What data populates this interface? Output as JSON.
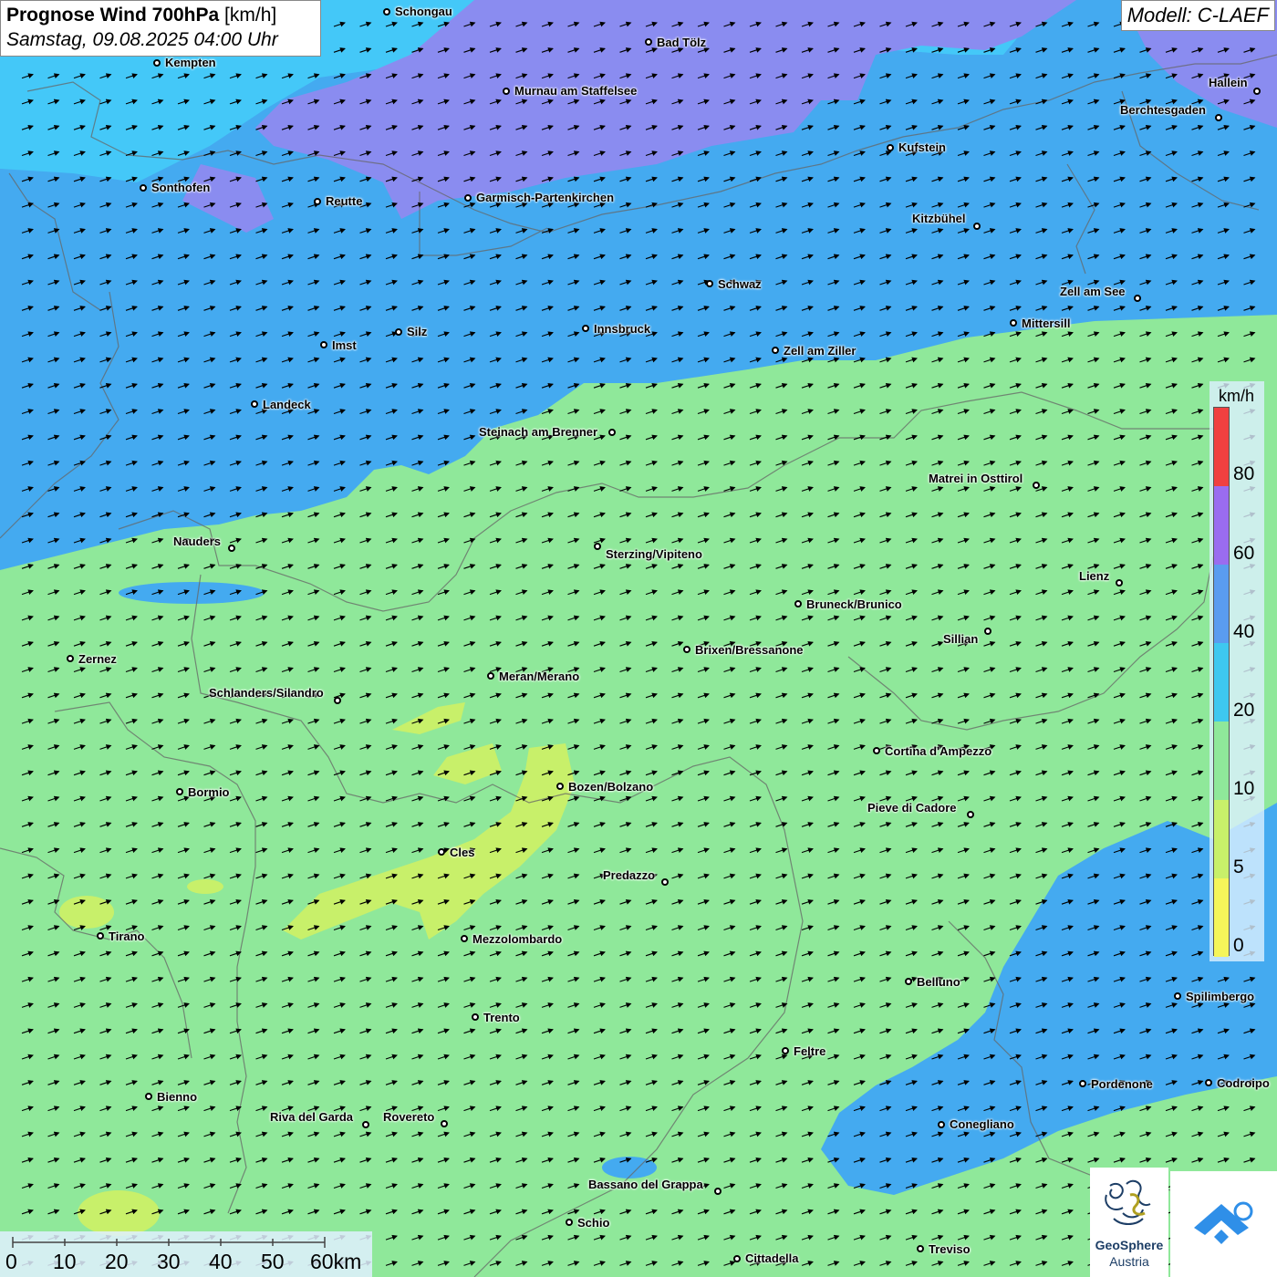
{
  "title": {
    "bold": "Prognose Wind 700hPa",
    "unit": "[km/h]",
    "datetime": "Samstag, 09.08.2025 04:00 Uhr"
  },
  "model": "Modell: C-LAEF",
  "colors": {
    "speed_0": "#f5f55a",
    "speed_5": "#c8f06a",
    "speed_10": "#8fe89a",
    "speed_20": "#3ec8f0",
    "speed_40": "#5a9cf0",
    "speed_60": "#9a6cf0",
    "speed_80": "#f04040",
    "blue_region": "#44aaf0",
    "violet_region": "#8a8cf0",
    "sky_region": "#44c8f8"
  },
  "legend": {
    "unit": "km/h",
    "labels": [
      "80",
      "60",
      "40",
      "20",
      "10",
      "5",
      "0"
    ]
  },
  "scale": {
    "labels": [
      "0",
      "10",
      "20",
      "30",
      "40",
      "50",
      "60km"
    ]
  },
  "logo": {
    "name1": "GeoSphere",
    "name2": "Austria"
  },
  "wind": {
    "arrow_icon": "wind-arrow-icon",
    "direction": "east-northeast"
  },
  "cities": [
    {
      "name": "Schongau"
    },
    {
      "name": "Bad Tölz"
    },
    {
      "name": "Kempten"
    },
    {
      "name": "Murnau am Staffelsee"
    },
    {
      "name": "Hallein"
    },
    {
      "name": "Berchtesgaden"
    },
    {
      "name": "Kufstein"
    },
    {
      "name": "Sonthofen"
    },
    {
      "name": "Reutte"
    },
    {
      "name": "Garmisch-Partenkirchen"
    },
    {
      "name": "Kitzbühel"
    },
    {
      "name": "Schwaz"
    },
    {
      "name": "Zell am See"
    },
    {
      "name": "Mittersill"
    },
    {
      "name": "Innsbruck"
    },
    {
      "name": "Silz"
    },
    {
      "name": "Imst"
    },
    {
      "name": "Zell am Ziller"
    },
    {
      "name": "Landeck"
    },
    {
      "name": "Steinach am Brenner"
    },
    {
      "name": "Matrei in Osttirol"
    },
    {
      "name": "Nauders"
    },
    {
      "name": "Sterzing/Vipiteno"
    },
    {
      "name": "Lienz"
    },
    {
      "name": "Bruneck/Brunico"
    },
    {
      "name": "Sillian"
    },
    {
      "name": "Zernez"
    },
    {
      "name": "Brixen/Bressanone"
    },
    {
      "name": "Meran/Merano"
    },
    {
      "name": "Schlanders/Silandro"
    },
    {
      "name": "Cortina d'Ampezzo"
    },
    {
      "name": "Bozen/Bolzano"
    },
    {
      "name": "Bormio"
    },
    {
      "name": "Pieve di Cadore"
    },
    {
      "name": "Cles"
    },
    {
      "name": "Predazzo"
    },
    {
      "name": "Tirano"
    },
    {
      "name": "Mezzolombardo"
    },
    {
      "name": "Belluno"
    },
    {
      "name": "Spilimbergo"
    },
    {
      "name": "Trento"
    },
    {
      "name": "Feltre"
    },
    {
      "name": "Pordenone"
    },
    {
      "name": "Codroipo"
    },
    {
      "name": "Bienno"
    },
    {
      "name": "Riva del Garda"
    },
    {
      "name": "Rovereto"
    },
    {
      "name": "Conegliano"
    },
    {
      "name": "Bassano del Grappa"
    },
    {
      "name": "Schio"
    },
    {
      "name": "Treviso"
    },
    {
      "name": "Cittadella"
    }
  ]
}
